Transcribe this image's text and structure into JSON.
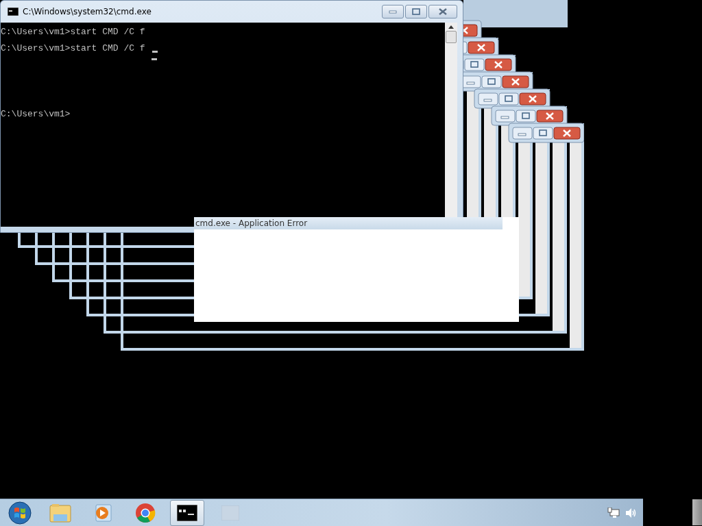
{
  "window": {
    "title": "C:\\Windows\\system32\\cmd.exe"
  },
  "console": {
    "lines": [
      {
        "text": "C:\\Users\\vm1>start CMD /C f",
        "cursor": false
      },
      {
        "text": "C:\\Users\\vm1>start CMD /C f",
        "cursor": true
      },
      {
        "text": "C:\\Users\\vm1>",
        "cursor": false
      }
    ]
  },
  "error_dialog": {
    "title": "cmd.exe - Application Error"
  },
  "taskbar": {
    "items": [
      {
        "kind": "start",
        "selected": false
      },
      {
        "kind": "folder",
        "selected": false
      },
      {
        "kind": "media",
        "selected": false
      },
      {
        "kind": "chrome",
        "selected": false
      },
      {
        "kind": "cmd",
        "selected": true
      },
      {
        "kind": "blank",
        "selected": false
      }
    ]
  }
}
